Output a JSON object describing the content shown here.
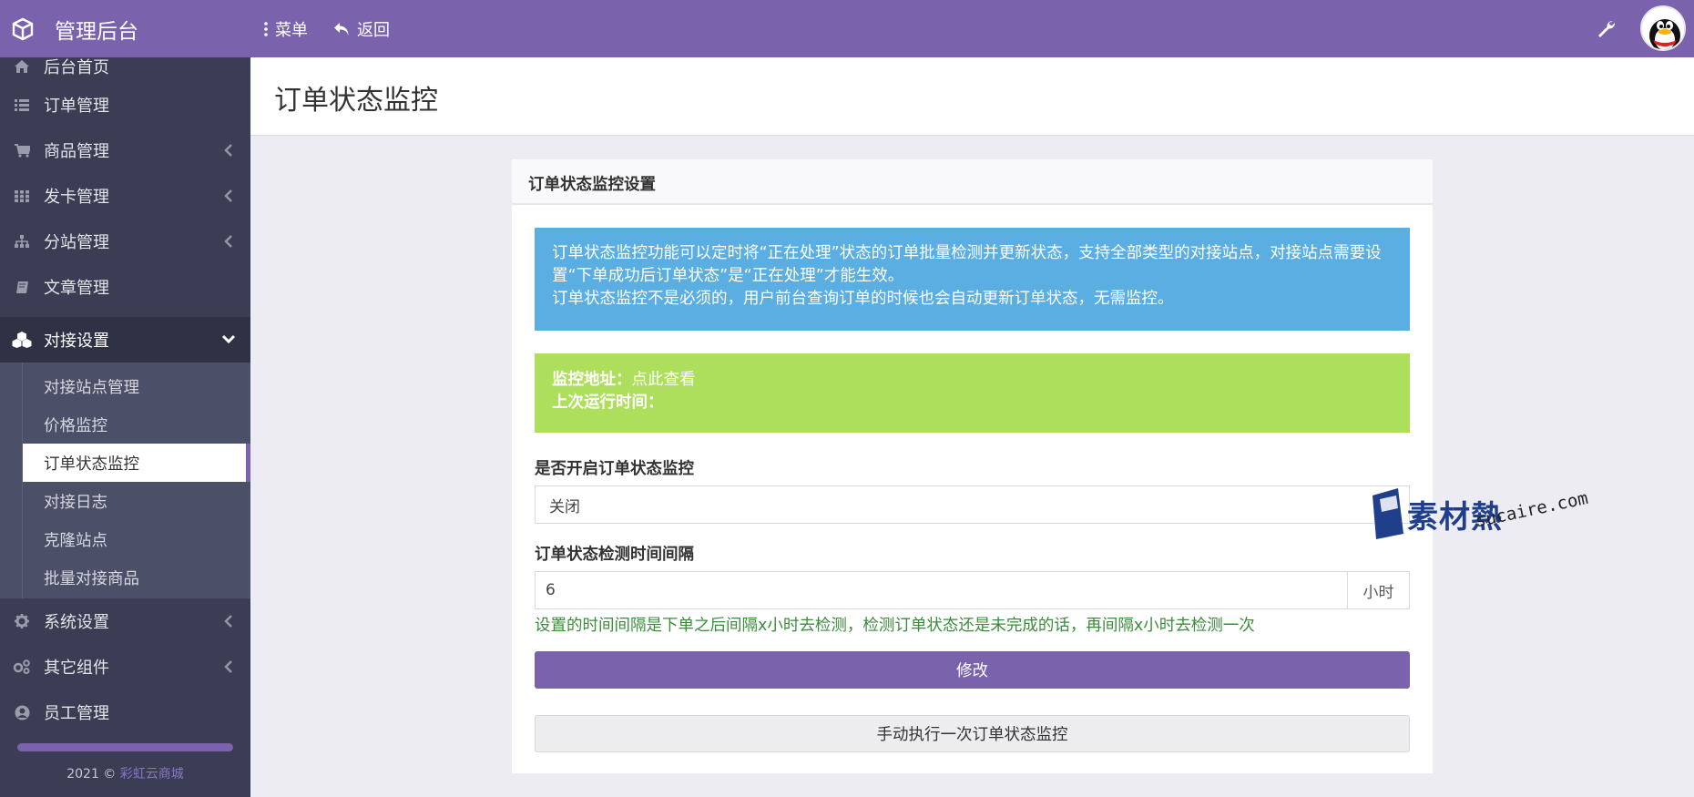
{
  "app": {
    "title": "管理后台",
    "menu_label": "菜单",
    "back_label": "返回"
  },
  "colors": {
    "brand": "#7b62ad",
    "sidebar_bg": "#3a3d53",
    "info": "#5aaee2",
    "success": "#aedf5c",
    "help_text": "#3c8a3c"
  },
  "sidebar": {
    "items": [
      {
        "label": "后台首页",
        "icon": "home-icon"
      },
      {
        "label": "订单管理",
        "icon": "list-icon"
      },
      {
        "label": "商品管理",
        "icon": "cart-icon"
      },
      {
        "label": "发卡管理",
        "icon": "grid-icon"
      },
      {
        "label": "分站管理",
        "icon": "sitemap-icon"
      },
      {
        "label": "文章管理",
        "icon": "book-icon"
      },
      {
        "label": "对接设置",
        "icon": "cubes-icon"
      },
      {
        "label": "系统设置",
        "icon": "gear-icon"
      },
      {
        "label": "其它组件",
        "icon": "gears-icon"
      },
      {
        "label": "员工管理",
        "icon": "user-icon"
      }
    ],
    "submenu": [
      "对接站点管理",
      "价格监控",
      "订单状态监控",
      "对接日志",
      "克隆站点",
      "批量对接商品"
    ],
    "footer_year": "2021 ©",
    "footer_link": "彩虹云商城"
  },
  "page": {
    "title": "订单状态监控"
  },
  "panel": {
    "title": "订单状态监控设置",
    "info_line1": "订单状态监控功能可以定时将“正在处理”状态的订单批量检测并更新状态，支持全部类型的对接站点，对接站点需要设置“下单成功后订单状态”是“正在处理”才能生效。",
    "info_line2": "订单状态监控不是必须的，用户前台查询订单的时候也会自动更新订单状态，无需监控。",
    "monitor_url_label": "监控地址：",
    "monitor_url_link": "点此查看",
    "last_run_label": "上次运行时间：",
    "enable_label": "是否开启订单状态监控",
    "enable_value": "关闭",
    "interval_label": "订单状态检测时间间隔",
    "interval_value": "6",
    "interval_unit": "小时",
    "help": "设置的时间间隔是下单之后间隔x小时去检测，检测订单状态还是未完成的话，再间隔x小时去检测一次",
    "submit": "修改",
    "run_once": "手动执行一次订单状态监控"
  },
  "watermark": {
    "text": "素材熱",
    "url": "sucaire.com"
  }
}
